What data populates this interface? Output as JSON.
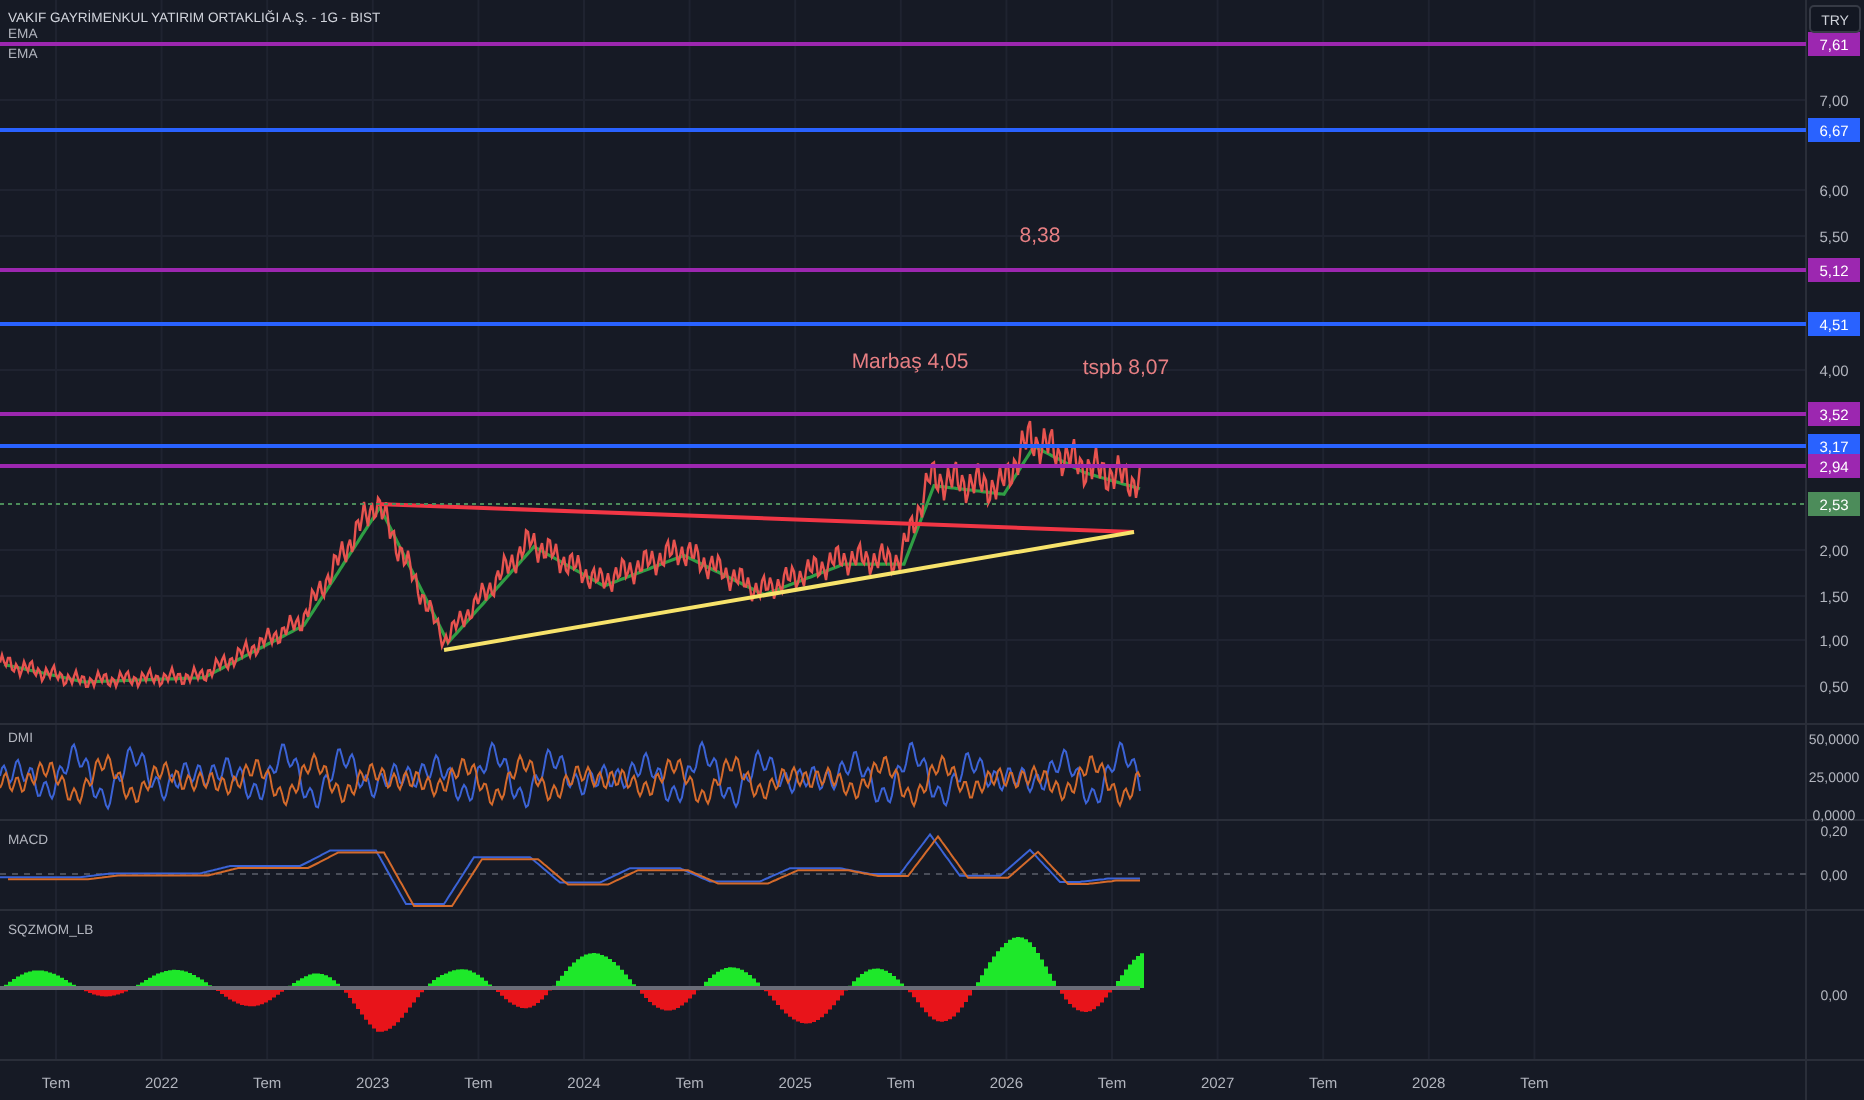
{
  "header": {
    "title": "VAKIF GAYRİMENKUL YATIRIM ORTAKLIĞI A.Ş. - 1G - BIST",
    "legends": [
      "EMA",
      "EMA"
    ]
  },
  "currency": "TRY",
  "price_axis": {
    "ticks": [
      "7,00",
      "6,00",
      "5,50",
      "4,00",
      "2,00",
      "1,50",
      "1,00",
      "0,50"
    ]
  },
  "levels": [
    {
      "label": "7,61",
      "color": "#9c27b0"
    },
    {
      "label": "6,67",
      "color": "#2962ff"
    },
    {
      "label": "5,12",
      "color": "#9c27b0"
    },
    {
      "label": "4,51",
      "color": "#2962ff"
    },
    {
      "label": "3,52",
      "color": "#9c27b0"
    },
    {
      "label": "3,17",
      "color": "#2962ff"
    },
    {
      "label": "2,94",
      "color": "#9c27b0"
    },
    {
      "label": "2,53",
      "color": "#4c8c5a"
    }
  ],
  "annotations": [
    "8,38",
    "Marbaş 4,05",
    "tspb 8,07"
  ],
  "panes": [
    {
      "title": "DMI",
      "ticks": [
        "50,0000",
        "25,0000",
        "0,0000"
      ]
    },
    {
      "title": "MACD",
      "ticks": [
        "0,20",
        "0,00"
      ]
    },
    {
      "title": "SQZMOM_LB",
      "ticks": [
        "0,00"
      ]
    }
  ],
  "time_axis": [
    "Tem",
    "2022",
    "Tem",
    "2023",
    "Tem",
    "2024",
    "Tem",
    "2025",
    "Tem",
    "2026",
    "Tem",
    "2027",
    "Tem",
    "2028",
    "Tem"
  ]
}
